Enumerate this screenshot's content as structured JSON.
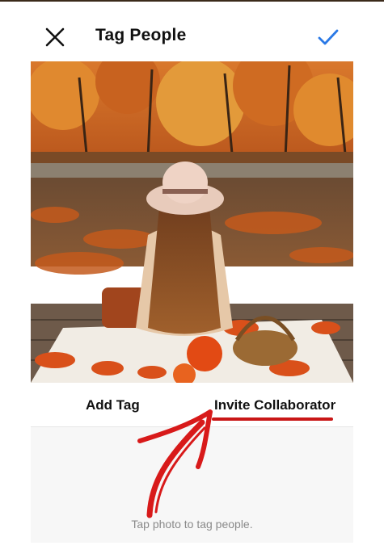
{
  "header": {
    "title": "Tag People",
    "close_icon": "close-icon",
    "done_icon": "checkmark-icon",
    "accent_color": "#2a79e6"
  },
  "tabs": [
    {
      "label": "Add Tag"
    },
    {
      "label": "Invite Collaborator",
      "highlight_color": "#c91616"
    }
  ],
  "hint": "Tap photo to tag people.",
  "annotation": {
    "arrow_icon": "red-arrow-icon",
    "color": "#d81a1a"
  }
}
